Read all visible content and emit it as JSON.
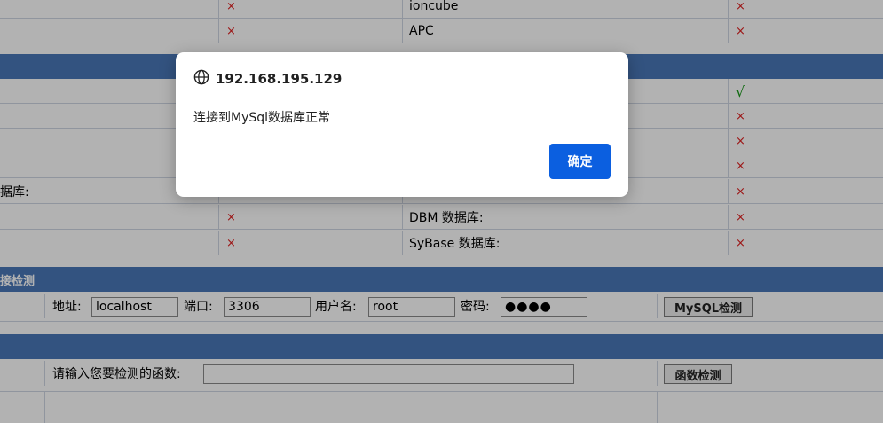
{
  "top_rows": [
    {
      "name": "ioncube",
      "status": "×"
    },
    {
      "name": "APC",
      "status": "×"
    }
  ],
  "db_rows": [
    {
      "right_status": "√"
    },
    {
      "right_status": "×"
    },
    {
      "right_status": "×"
    },
    {
      "right_status": "×"
    },
    {
      "left_label": "据库:",
      "right_status": "×"
    },
    {
      "left_status": "×",
      "name": "DBM 数据库:",
      "right_status": "×"
    },
    {
      "left_status": "×",
      "name": "SyBase 数据库:",
      "right_status": "×"
    }
  ],
  "mysql_section": {
    "title": "接检测",
    "address_label": "地址:",
    "address_value": "localhost",
    "port_label": "端口:",
    "port_value": "3306",
    "user_label": "用户名:",
    "user_value": "root",
    "password_label": "密码:",
    "password_value": "●●●●",
    "check_button": "MySQL检测"
  },
  "function_section": {
    "prompt_label": "请输入您要检测的函数:",
    "input_value": "",
    "check_button": "函数检测"
  },
  "dialog": {
    "title": "192.168.195.129",
    "message": "连接到MySql数据库正常",
    "ok_button": "确定"
  },
  "colors": {
    "section_band": "#4a78b8",
    "fail": "#e02020",
    "ok": "#1a9a1a",
    "dialog_button": "#0b5fe0"
  }
}
